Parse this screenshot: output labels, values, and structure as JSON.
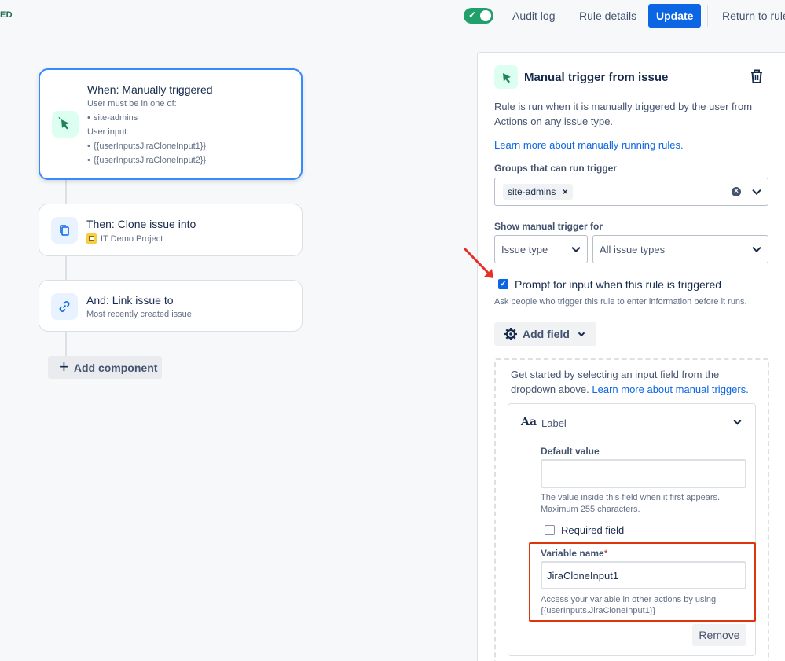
{
  "topbar": {
    "status": "ED",
    "audit_log": "Audit log",
    "rule_details": "Rule details",
    "update": "Update",
    "return": "Return to rule"
  },
  "flow": {
    "trigger": {
      "title": "When: Manually triggered",
      "groups_label": "User must be in one of:",
      "groups": [
        "site-admins"
      ],
      "input_label": "User input:",
      "inputs": [
        "{{userInputsJiraCloneInput1}}",
        "{{userInputsJiraCloneInput2}}"
      ]
    },
    "clone": {
      "title": "Then: Clone issue into",
      "project": "IT Demo Project"
    },
    "link": {
      "title": "And: Link issue to",
      "sub": "Most recently created issue"
    },
    "add_component": "Add component"
  },
  "panel": {
    "title": "Manual trigger from issue",
    "desc_line1": "Rule is run when it is manually triggered by the user from",
    "desc_line2": "Actions on any issue type.",
    "learn_link": "Learn more about manually running rules.",
    "groups_label": "Groups that can run trigger",
    "groups_tag": "site-admins",
    "show_label": "Show manual trigger for",
    "issue_type_select": "Issue type",
    "issue_types_select": "All issue types",
    "prompt_label": "Prompt for input when this rule is triggered",
    "prompt_help": "Ask people who trigger this rule to enter information before it runs.",
    "add_field": "Add field",
    "get_started_line1": "Get started by selecting an input field from the",
    "get_started_line2": "dropdown above.",
    "get_started_link": "Learn more about manual triggers.",
    "field": {
      "type_icon": "Aa",
      "type_label": "Label",
      "default_label": "Default value",
      "default_value": "",
      "default_help1": "The value inside this field when it first appears.",
      "default_help2": "Maximum 255 characters.",
      "required_label": "Required field",
      "variable_label": "Variable name",
      "required_mark": "*",
      "variable_value": "JiraCloneInput1",
      "variable_help1": "Access your variable in other actions by using",
      "variable_help2": "{{userInputs.JiraCloneInput1}}",
      "remove": "Remove"
    }
  },
  "colors": {
    "accent": "#0c66e4",
    "toggle_on": "#22a06b",
    "highlight": "#de350b"
  }
}
